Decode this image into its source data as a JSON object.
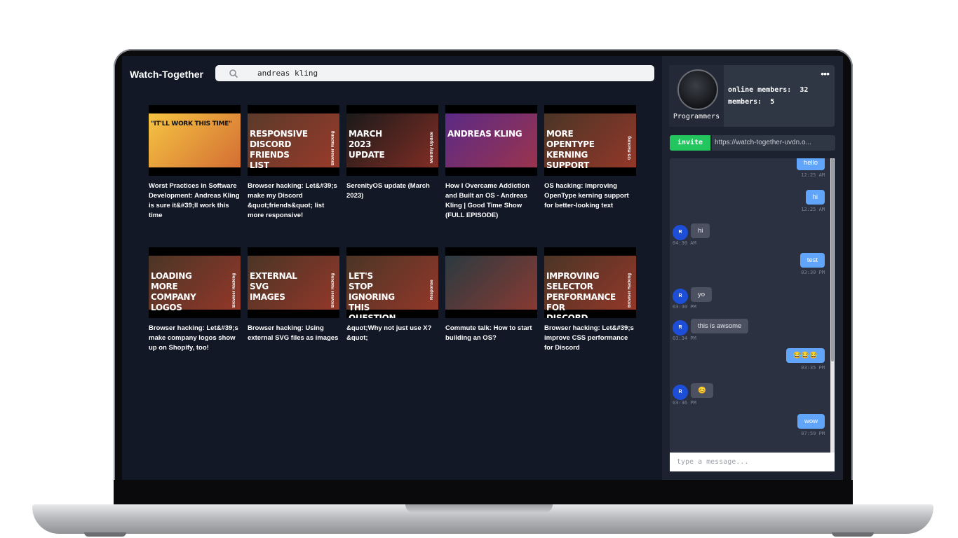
{
  "app": {
    "title": "Watch-Together"
  },
  "search": {
    "value": "andreas kling"
  },
  "videos": [
    {
      "title": "Worst Practices in Software Development: Andreas Kling is sure it&#39;ll work this time",
      "thumb_text": "\"IT'LL WORK THIS TIME\"",
      "thumb_side": "",
      "bg": "#f5c542"
    },
    {
      "title": "Browser hacking: Let&#39;s make my Discord &quot;friends&quot; list more responsive!",
      "thumb_text": "RESPONSIVE DISCORD FRIENDS LIST",
      "thumb_side": "Browser Hacking",
      "bg": "#5a3a2a"
    },
    {
      "title": "SerenityOS update (March 2023)",
      "thumb_text": "MARCH 2023 UPDATE",
      "thumb_side": "Monthly Update",
      "bg": "#1a1a1a"
    },
    {
      "title": "How I Overcame Addiction and Built an OS - Andreas Kling | Good Time Show (FULL EPISODE)",
      "thumb_text": "ANDREAS KLING",
      "thumb_side": "",
      "bg": "#5b2a86"
    },
    {
      "title": "OS hacking: Improving OpenType kerning support for better-looking text",
      "thumb_text": "MORE OPENTYPE KERNING SUPPORT",
      "thumb_side": "OS Hacking",
      "bg": "#4a3526"
    },
    {
      "title": "Browser hacking: Let&#39;s make company logos show up on Shopify, too!",
      "thumb_text": "LOADING MORE COMPANY LOGOS",
      "thumb_side": "Browser Hacking",
      "bg": "#4a3526"
    },
    {
      "title": "Browser hacking: Using external SVG files as images",
      "thumb_text": "EXTERNAL SVG IMAGES",
      "thumb_side": "Browser Hacking",
      "bg": "#4a3526"
    },
    {
      "title": "&quot;Why not just use X?&quot;",
      "thumb_text": "LET'S STOP IGNORING THIS QUESTION",
      "thumb_side": "Response",
      "bg": "#4a3526"
    },
    {
      "title": "Commute talk: How to start building an OS?",
      "thumb_text": "",
      "thumb_side": "",
      "bg": "#2b3a40"
    },
    {
      "title": "Browser hacking: Let&#39;s improve CSS performance for Discord",
      "thumb_text": "IMPROVING SELECTOR PERFORMANCE FOR DISCORD",
      "thumb_side": "Browser Hacking",
      "bg": "#4a3526"
    }
  ],
  "room": {
    "name": "Programmers",
    "online_label": "online members:",
    "online_count": "32",
    "members_label": "members:",
    "members_count": "5",
    "invite_label": "invite",
    "invite_link": "https://watch-together-uvdn.o..."
  },
  "messages": [
    {
      "dir": "out",
      "text": "hello",
      "time": "12:25 AM"
    },
    {
      "dir": "out",
      "text": "hi",
      "time": "12:25 AM"
    },
    {
      "dir": "in",
      "text": "hi",
      "time": "04:30 AM"
    },
    {
      "dir": "out",
      "text": "test",
      "time": "03:30 PM"
    },
    {
      "dir": "in",
      "text": "yo",
      "time": "03:30 PM"
    },
    {
      "dir": "in",
      "text": "this is awsome",
      "time": "03:34 PM"
    },
    {
      "dir": "out",
      "text": "😂😂😂",
      "time": "03:35 PM"
    },
    {
      "dir": "in",
      "text": "😊",
      "time": "03:36 PM"
    },
    {
      "dir": "out",
      "text": "wow",
      "time": "07:59 PM"
    }
  ],
  "composer": {
    "placeholder": "type a message..."
  },
  "colors": {
    "accent": "#60a5fa",
    "invite": "#22c55e",
    "background": "#121826",
    "panel": "#1c2230"
  }
}
